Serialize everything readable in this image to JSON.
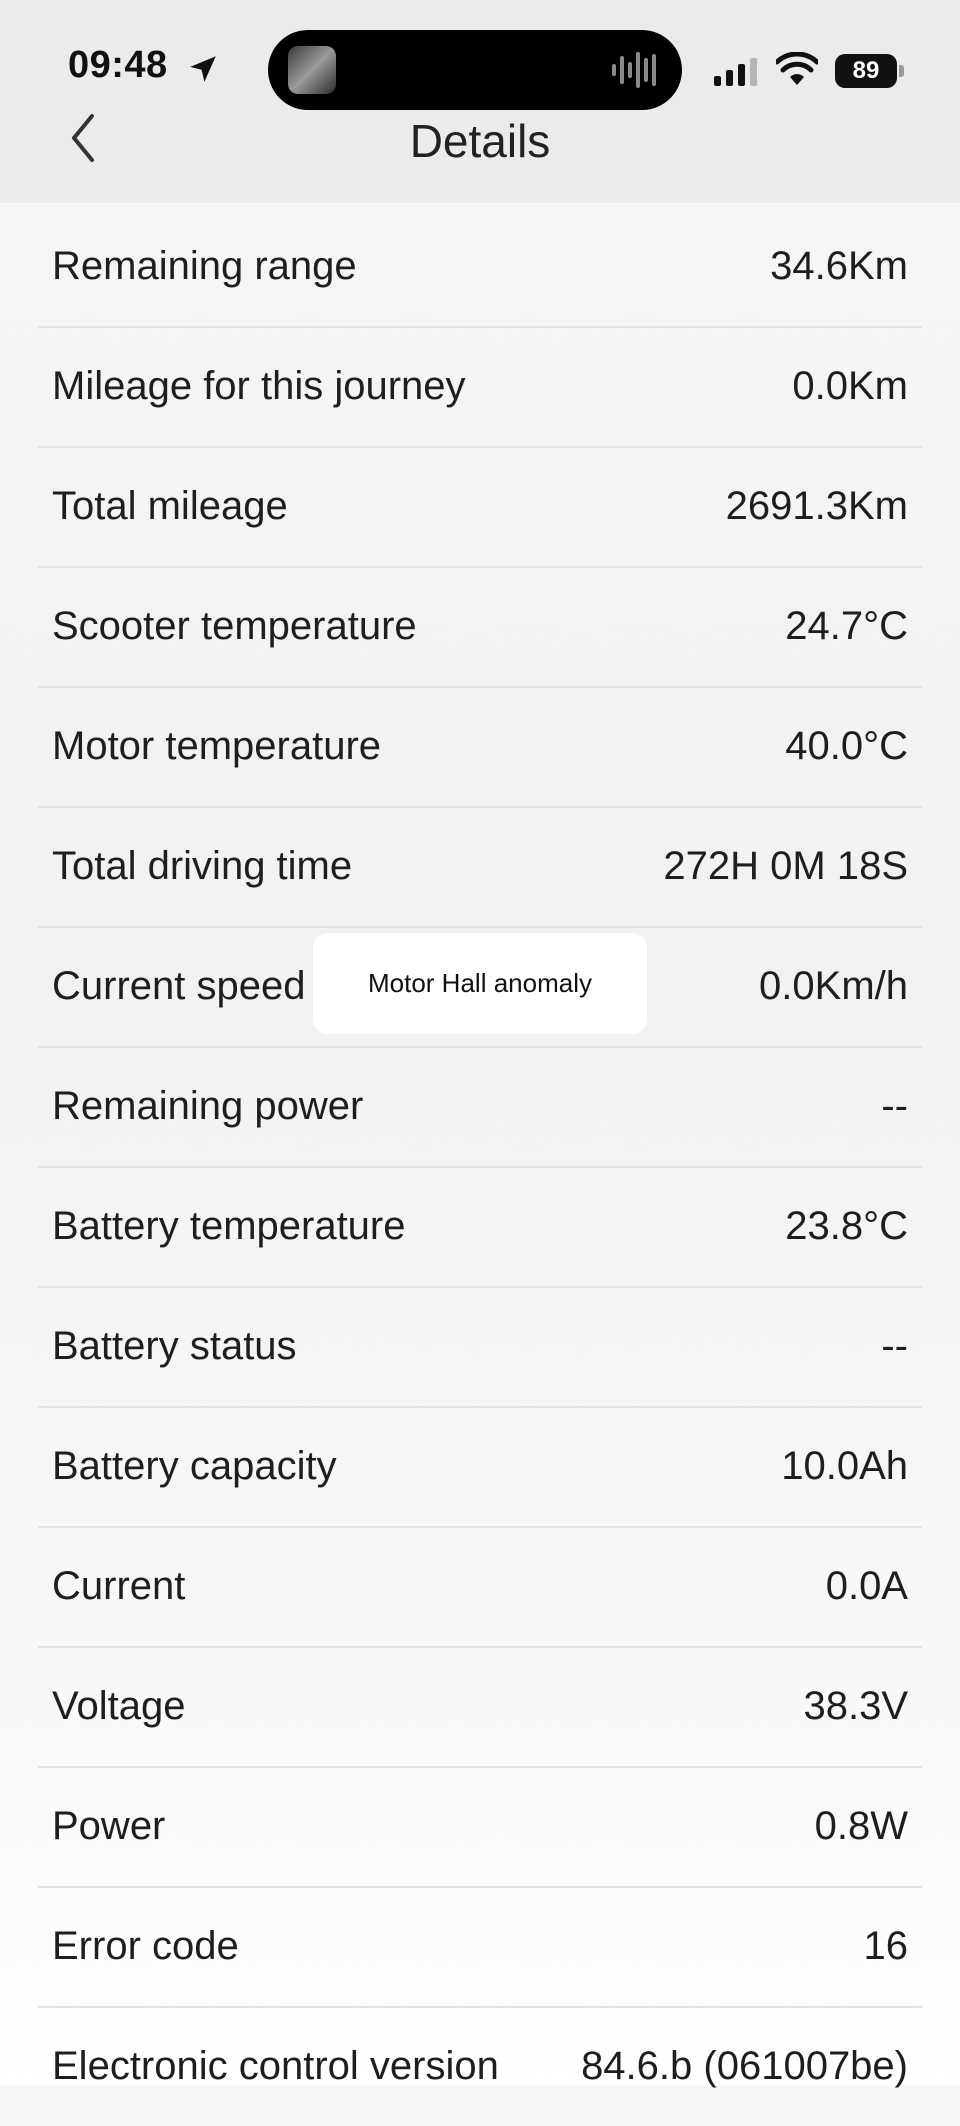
{
  "status_bar": {
    "time": "09:48",
    "battery_level": "89",
    "icons": [
      "location-arrow-icon",
      "signal-icon",
      "wifi-icon",
      "battery-icon"
    ]
  },
  "header": {
    "title": "Details",
    "back_icon": "chevron-left-icon"
  },
  "rows": [
    {
      "label": "Remaining range",
      "value": "34.6Km"
    },
    {
      "label": "Mileage for this journey",
      "value": "0.0Km"
    },
    {
      "label": "Total mileage",
      "value": "2691.3Km"
    },
    {
      "label": "Scooter temperature",
      "value": "24.7°C"
    },
    {
      "label": "Motor temperature",
      "value": "40.0°C"
    },
    {
      "label": "Total driving time",
      "value": "272H 0M 18S"
    },
    {
      "label": "Current speed",
      "value": "0.0Km/h"
    },
    {
      "label": "Remaining power",
      "value": "--"
    },
    {
      "label": "Battery temperature",
      "value": "23.8°C"
    },
    {
      "label": "Battery status",
      "value": "--"
    },
    {
      "label": "Battery capacity",
      "value": "10.0Ah"
    },
    {
      "label": "Current",
      "value": "0.0A"
    },
    {
      "label": "Voltage",
      "value": "38.3V"
    },
    {
      "label": "Power",
      "value": "0.8W"
    },
    {
      "label": "Error code",
      "value": "16"
    },
    {
      "label": "Electronic control version",
      "value": "84.6.b (061007be)"
    }
  ],
  "toast": {
    "message": "Motor Hall anomaly"
  },
  "colors": {
    "header_background": "#ebebeb",
    "divider": "#e2e2e2",
    "text": "#1e1e1e"
  }
}
